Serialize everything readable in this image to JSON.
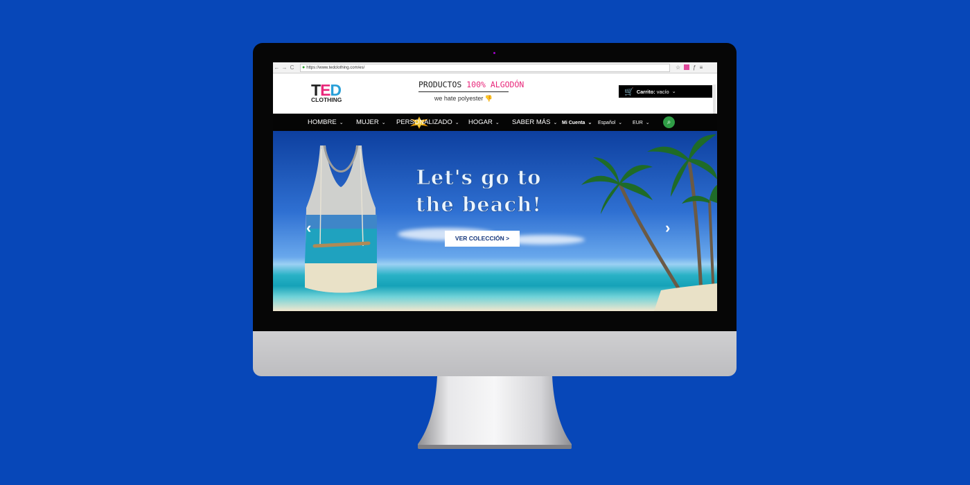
{
  "browser": {
    "url": "https://www.tedclothing.com/es/",
    "nav_back": "←",
    "nav_forward": "→",
    "nav_reload": "C"
  },
  "header": {
    "logo_main_t": "T",
    "logo_main_e": "E",
    "logo_main_d": "D",
    "logo_sub": "CLOTHING",
    "slogan_part1": "PRODUCTOS ",
    "slogan_part2": "100% ALGODÓN",
    "slogan_bottom": "we hate polyester",
    "cart_label": "Carrito:",
    "cart_status": "vacío"
  },
  "nav": {
    "items": [
      "HOMBRE",
      "MUJER",
      "PERSONALIZADO",
      "HOGAR",
      "SABER MÁS"
    ],
    "account": "Mi Cuenta",
    "language": "Español",
    "currency": "EUR"
  },
  "hero": {
    "title_line1": "Let's go to",
    "title_line2": "the beach!",
    "button_label": "VER COLECCIÓN  >"
  },
  "colors": {
    "background": "#0747b8",
    "accent_pink": "#e8267a",
    "search_green": "#2f9c45",
    "nav_bg": "#050505"
  },
  "icons": [
    "cart-icon",
    "search-icon",
    "thumbs-down-icon",
    "chevron-down-icon",
    "chevron-left-icon",
    "chevron-right-icon",
    "lock-icon",
    "star-icon"
  ]
}
